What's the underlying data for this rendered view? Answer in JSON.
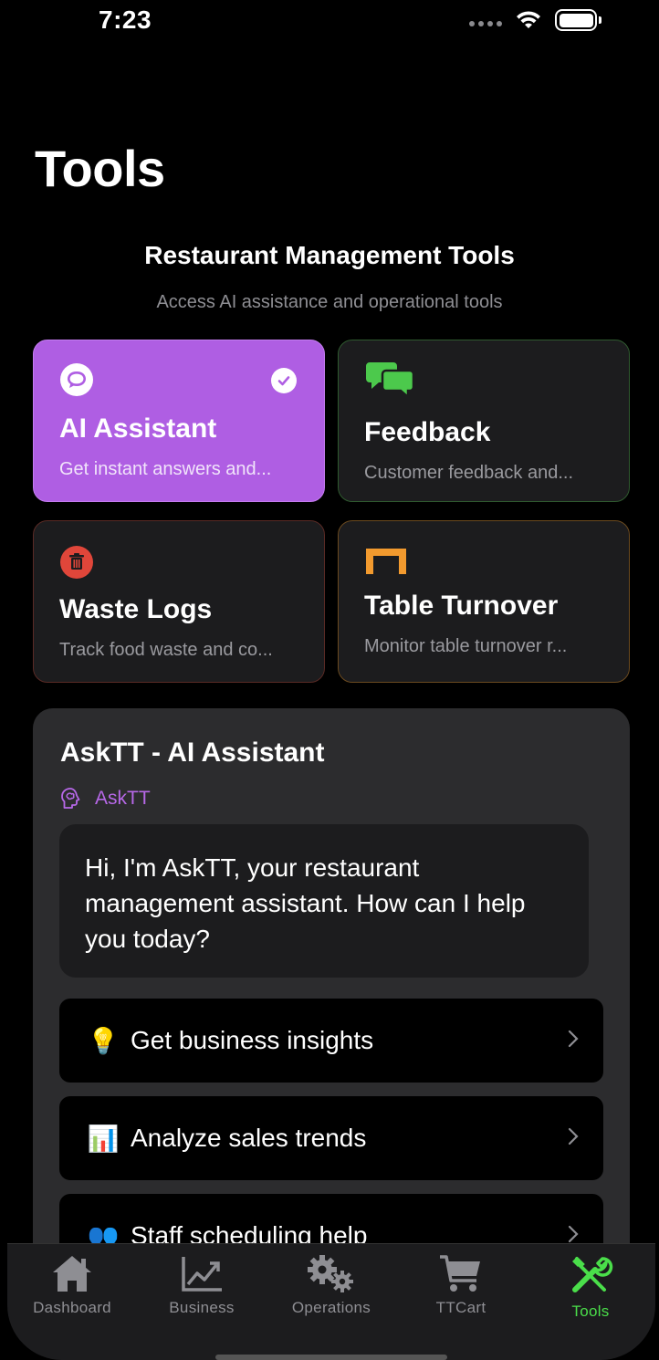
{
  "status": {
    "time": "7:23"
  },
  "page": {
    "title": "Tools"
  },
  "section": {
    "heading": "Restaurant Management Tools",
    "subheading": "Access AI assistance and operational tools"
  },
  "tools": [
    {
      "title": "AI Assistant",
      "desc": "Get instant answers and...",
      "icon": "chat-bubble-icon",
      "color": "#af5ee3",
      "selected": true
    },
    {
      "title": "Feedback",
      "desc": "Customer feedback and...",
      "icon": "speech-bubbles-icon",
      "color": "#4cc94c",
      "selected": false
    },
    {
      "title": "Waste Logs",
      "desc": "Track food waste and co...",
      "icon": "trash-icon",
      "color": "#e0463a",
      "selected": false
    },
    {
      "title": "Table Turnover",
      "desc": "Monitor table turnover r...",
      "icon": "table-icon",
      "color": "#f29a2e",
      "selected": false
    }
  ],
  "chat": {
    "title": "AskTT - AI Assistant",
    "agent_name": "AskTT",
    "message": "Hi, I'm AskTT, your restaurant management assistant. How can I help you today?",
    "suggestions": [
      {
        "emoji": "💡",
        "label": "Get business insights"
      },
      {
        "emoji": "📊",
        "label": "Analyze sales trends"
      },
      {
        "emoji": "👥",
        "label": "Staff scheduling help"
      }
    ]
  },
  "tabs": [
    {
      "label": "Dashboard",
      "icon": "home-icon",
      "active": false
    },
    {
      "label": "Business",
      "icon": "chart-icon",
      "active": false
    },
    {
      "label": "Operations",
      "icon": "gears-icon",
      "active": false
    },
    {
      "label": "TTCart",
      "icon": "cart-icon",
      "active": false
    },
    {
      "label": "Tools",
      "icon": "tools-icon",
      "active": true
    }
  ],
  "colors": {
    "accent_purple": "#af5ee3",
    "active_tab": "#4ade4a",
    "background": "#000000",
    "card": "#1c1c1e"
  }
}
